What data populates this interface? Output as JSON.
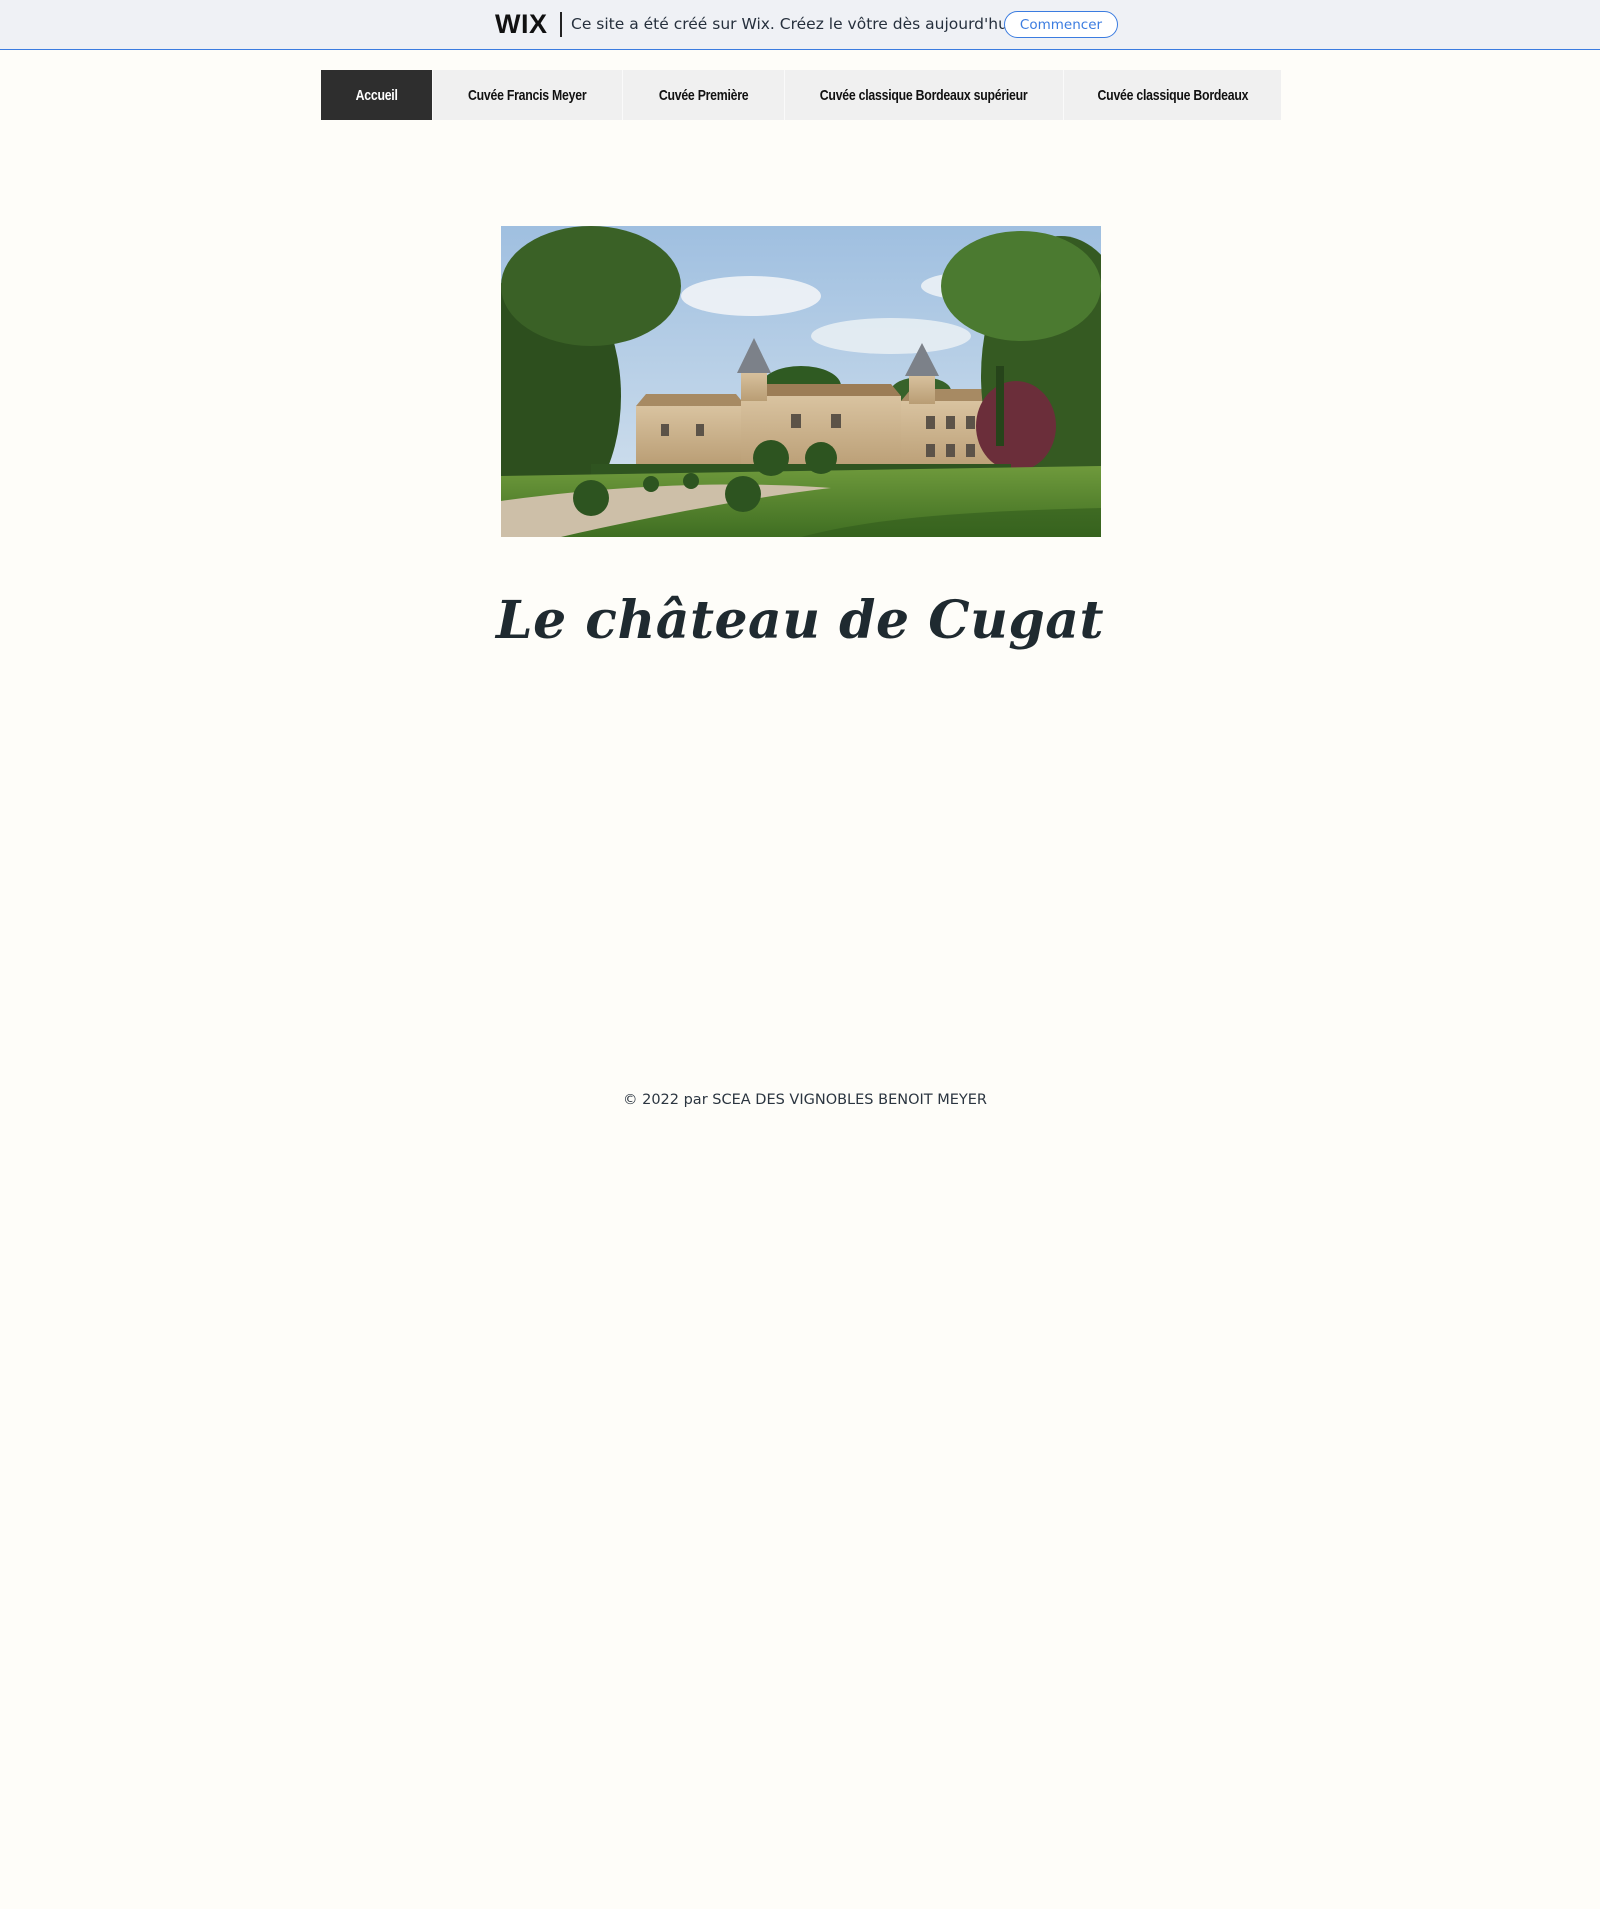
{
  "banner": {
    "logo": "WIX",
    "message": "Ce site a été créé sur Wix. Créez le vôtre dès aujourd'hui.",
    "cta_label": "Commencer",
    "accent_color": "#3b7ce0"
  },
  "nav": {
    "items": [
      {
        "label": "Accueil",
        "active": true
      },
      {
        "label": "Cuvée Francis Meyer",
        "active": false
      },
      {
        "label": "Cuvée Première",
        "active": false
      },
      {
        "label": "Cuvée classique Bordeaux supérieur",
        "active": false
      },
      {
        "label": "Cuvée classique Bordeaux",
        "active": false
      }
    ]
  },
  "hero": {
    "icon": "chateau-photo"
  },
  "main": {
    "title": "Le château de Cugat"
  },
  "footer": {
    "copyright": "© 2022 par SCEA DES VIGNOBLES BENOIT MEYER"
  },
  "colors": {
    "page_background": "#fefdf9",
    "nav_active_bg": "#2e2e2e",
    "nav_bg": "#f0f0f0"
  }
}
